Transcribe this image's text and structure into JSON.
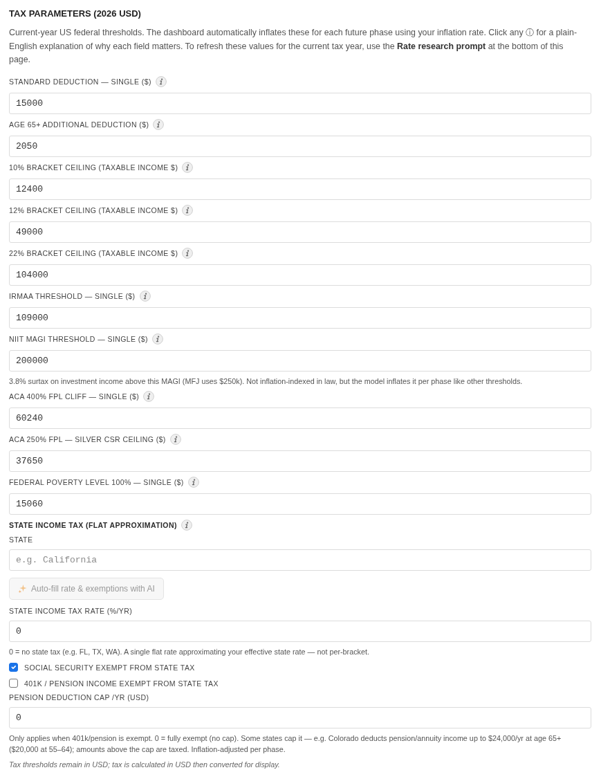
{
  "section": {
    "title": "TAX PARAMETERS (2026 USD)",
    "description": "Current-year US federal thresholds. The dashboard automatically inflates these for each future phase using your inflation rate. Click any ⓘ for a plain-English explanation of why each field matters. To refresh these values for the current tax year, use the **Rate research prompt** at the bottom of this page."
  },
  "items": [
    {
      "kind": "field",
      "label": "STANDARD DEDUCTION — SINGLE ($)",
      "info": true,
      "value": "15000"
    },
    {
      "kind": "field",
      "label": "AGE 65+ ADDITIONAL DEDUCTION ($)",
      "info": true,
      "value": "2050"
    },
    {
      "kind": "field",
      "label": "10% BRACKET CEILING (TAXABLE INCOME $)",
      "info": true,
      "value": "12400"
    },
    {
      "kind": "field",
      "label": "12% BRACKET CEILING (TAXABLE INCOME $)",
      "info": true,
      "value": "49000"
    },
    {
      "kind": "field",
      "label": "22% BRACKET CEILING (TAXABLE INCOME $)",
      "info": true,
      "value": "104000"
    },
    {
      "kind": "field",
      "label": "IRMAA THRESHOLD — SINGLE ($)",
      "info": true,
      "value": "109000"
    },
    {
      "kind": "field",
      "label": "NIIT MAGI THRESHOLD — SINGLE ($)",
      "info": true,
      "value": "200000",
      "help": "3.8% surtax on investment income above this MAGI (MFJ uses $250k). Not inflation-indexed in law, but the model inflates it per phase like other thresholds."
    },
    {
      "kind": "field",
      "label": "ACA 400% FPL CLIFF — SINGLE ($)",
      "info": true,
      "value": "60240"
    },
    {
      "kind": "field",
      "label": "ACA 250% FPL — SILVER CSR CEILING ($)",
      "info": true,
      "value": "37650"
    },
    {
      "kind": "field",
      "label": "FEDERAL POVERTY LEVEL 100% — SINGLE ($)",
      "info": true,
      "value": "15060"
    },
    {
      "kind": "heading",
      "label": "STATE INCOME TAX (FLAT APPROXIMATION)",
      "info": true
    },
    {
      "kind": "field",
      "label": "STATE",
      "info": false,
      "placeholder": "e.g. California"
    },
    {
      "kind": "button",
      "label": "Auto-fill rate & exemptions with AI",
      "disabled": true
    },
    {
      "kind": "field",
      "label": "STATE INCOME TAX RATE (%/YR)",
      "info": false,
      "value": "0",
      "help": "0 = no state tax (e.g. FL, TX, WA). A single flat rate approximating your effective state rate — not per-bracket."
    },
    {
      "kind": "checkbox",
      "label": "SOCIAL SECURITY EXEMPT FROM STATE TAX",
      "checked": true
    },
    {
      "kind": "checkbox",
      "label": "401K / PENSION INCOME EXEMPT FROM STATE TAX",
      "checked": false
    },
    {
      "kind": "field",
      "label": "PENSION DEDUCTION CAP /YR (USD)",
      "info": false,
      "value": "0",
      "help": "Only applies when 401k/pension is exempt. 0 = fully exempt (no cap). Some states cap it — e.g. Colorado deducts pension/annuity income up to $24,000/yr at age 65+ ($20,000 at 55–64); amounts above the cap are taxed. Inflation-adjusted per phase."
    },
    {
      "kind": "note",
      "text": "Tax thresholds remain in USD; tax is calculated in USD then converted for display."
    }
  ]
}
